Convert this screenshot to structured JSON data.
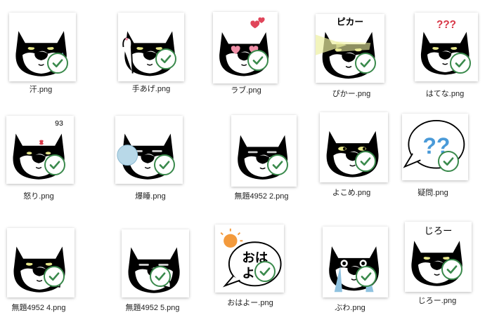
{
  "view": "icon-grid",
  "accent_color": "#3a8a4c",
  "items": [
    {
      "name": "汗.png",
      "thumb": "cat-sweat",
      "status_icon": "checkmark-icon"
    },
    {
      "name": "手あげ.png",
      "thumb": "cat-raise-hand",
      "status_icon": "checkmark-icon"
    },
    {
      "name": "ラブ.png",
      "thumb": "cat-love",
      "status_icon": "checkmark-icon"
    },
    {
      "name": "ぴかー.png",
      "thumb": "cat-shine",
      "status_icon": "checkmark-icon",
      "overlay_text": "ピカー"
    },
    {
      "name": "はてな.png",
      "thumb": "cat-question",
      "status_icon": "checkmark-icon",
      "overlay_text": "???"
    },
    {
      "name": "怒り.png",
      "thumb": "cat-angry",
      "status_icon": "checkmark-icon"
    },
    {
      "name": "爆睡.png",
      "thumb": "cat-sleep",
      "status_icon": "checkmark-icon"
    },
    {
      "name": "無題4952 2.png",
      "thumb": "cat-plain",
      "status_icon": "checkmark-icon"
    },
    {
      "name": "よこめ.png",
      "thumb": "cat-side-eye",
      "status_icon": "checkmark-icon"
    },
    {
      "name": "疑問.png",
      "thumb": "speech-question",
      "status_icon": "checkmark-icon",
      "overlay_text": "??"
    },
    {
      "name": "無題4952 4.png",
      "thumb": "cat-paw",
      "status_icon": "checkmark-icon"
    },
    {
      "name": "無題4952 5.png",
      "thumb": "cat-paw-sleepy",
      "status_icon": "checkmark-icon"
    },
    {
      "name": "おはよー.png",
      "thumb": "speech-morning",
      "status_icon": "checkmark-icon",
      "overlay_text": "おは よー"
    },
    {
      "name": "ぶわ.png",
      "thumb": "cat-cry",
      "status_icon": "checkmark-icon"
    },
    {
      "name": "じろー.png",
      "thumb": "cat-stare",
      "status_icon": "checkmark-icon",
      "overlay_text": "じろー"
    }
  ]
}
